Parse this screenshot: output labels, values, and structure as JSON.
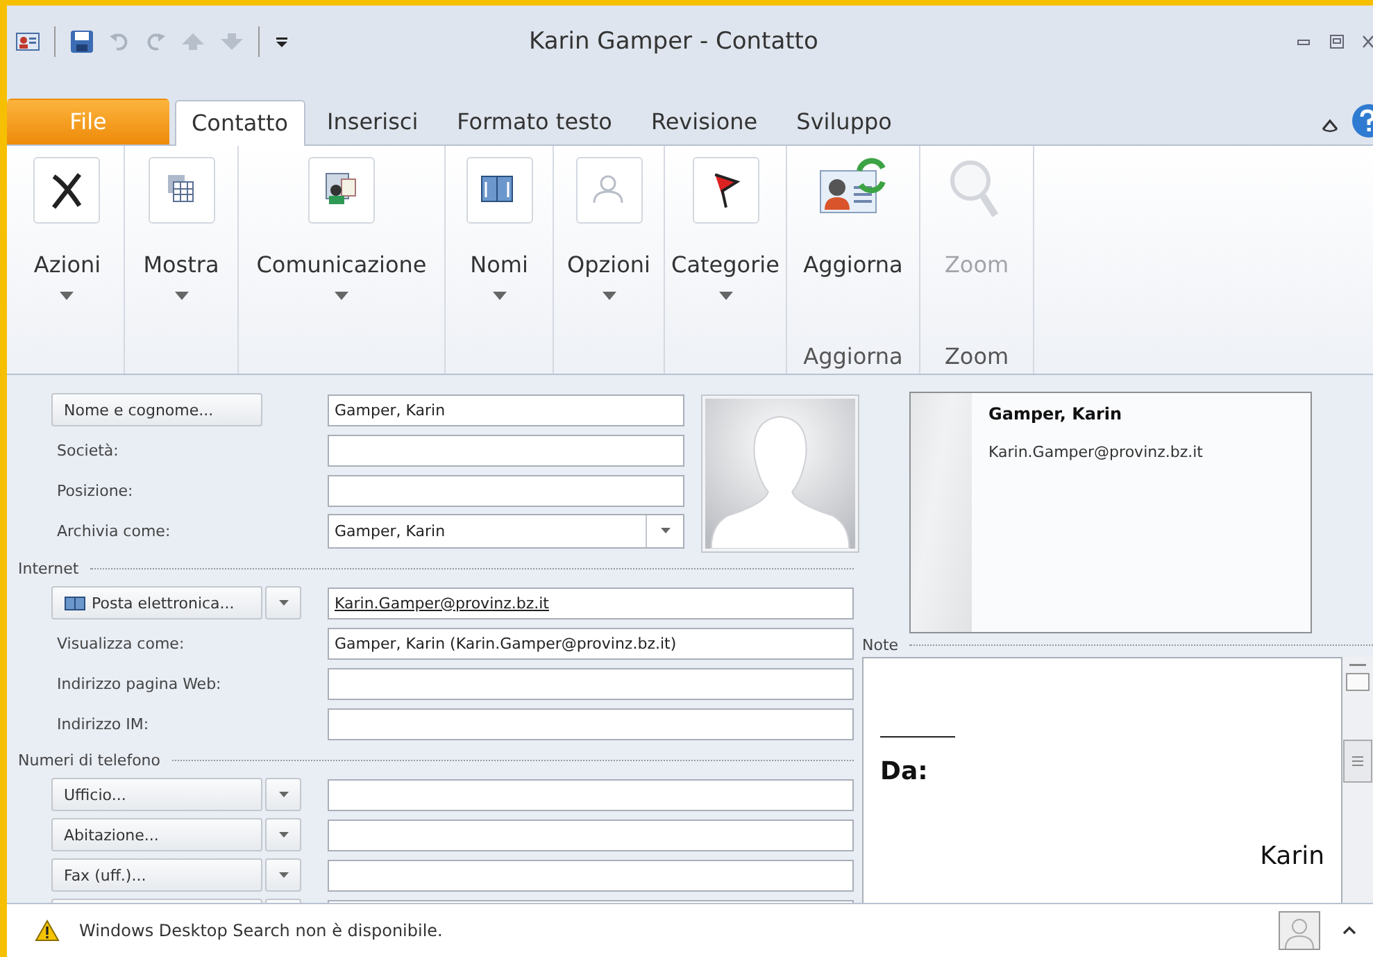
{
  "window": {
    "title": "Karin Gamper - Contatto"
  },
  "tabs": [
    {
      "label": "File",
      "kind": "file",
      "selected": false
    },
    {
      "label": "Contatto",
      "kind": "tab",
      "selected": true
    },
    {
      "label": "Inserisci",
      "kind": "tab",
      "selected": false
    },
    {
      "label": "Formato testo",
      "kind": "tab",
      "selected": false
    },
    {
      "label": "Revisione",
      "kind": "tab",
      "selected": false
    },
    {
      "label": "Sviluppo",
      "kind": "tab",
      "selected": false
    }
  ],
  "ribbon": {
    "groups": [
      {
        "label": "Azioni",
        "kind": "menu",
        "disabled": false
      },
      {
        "label": "Mostra",
        "kind": "menu",
        "disabled": false
      },
      {
        "label": "Comunicazione",
        "kind": "menu",
        "disabled": false
      },
      {
        "label": "Nomi",
        "kind": "menu",
        "disabled": false
      },
      {
        "label": "Opzioni",
        "kind": "menu",
        "disabled": false
      },
      {
        "label": "Categorie",
        "kind": "menu",
        "disabled": false
      },
      {
        "label": "Aggiorna",
        "kind": "large",
        "disabled": false,
        "group_label": "Aggiorna"
      },
      {
        "label": "Zoom",
        "kind": "large",
        "disabled": true,
        "group_label": "Zoom"
      }
    ]
  },
  "form": {
    "rows": [
      {
        "kind": "button",
        "label": "Nome e cognome...",
        "value": "Gamper, Karin"
      },
      {
        "kind": "label",
        "label": "Società:"
      },
      {
        "kind": "label",
        "label": "Posizione:"
      },
      {
        "kind": "combo",
        "label": "Archivia come:",
        "value": "Gamper, Karin"
      }
    ],
    "sections": [
      {
        "title": "Internet",
        "rows": [
          {
            "kind": "split",
            "label": "Posta elettronica...",
            "value": "Karin.Gamper@provinz.bz.it",
            "link": true
          },
          {
            "kind": "label",
            "label": "Visualizza come:",
            "value": "Gamper, Karin (Karin.Gamper@provinz.bz.it)"
          },
          {
            "kind": "label",
            "label": "Indirizzo pagina Web:"
          },
          {
            "kind": "label",
            "label": "Indirizzo IM:"
          }
        ]
      },
      {
        "title": "Numeri di telefono",
        "rows": [
          {
            "kind": "split",
            "label": "Ufficio..."
          },
          {
            "kind": "split",
            "label": "Abitazione..."
          },
          {
            "kind": "split",
            "label": "Fax (uff.)..."
          },
          {
            "kind": "split"
          }
        ]
      }
    ]
  },
  "card": {
    "name": "Gamper, Karin",
    "email": "Karin.Gamper@provinz.bz.it"
  },
  "notes": {
    "title": "Note",
    "lines": [
      {
        "kind": "heading",
        "text": "Da:"
      },
      {
        "kind": "right",
        "text": "Karin"
      }
    ]
  },
  "status_bar": {
    "message": "Windows Desktop Search non è disponibile."
  }
}
